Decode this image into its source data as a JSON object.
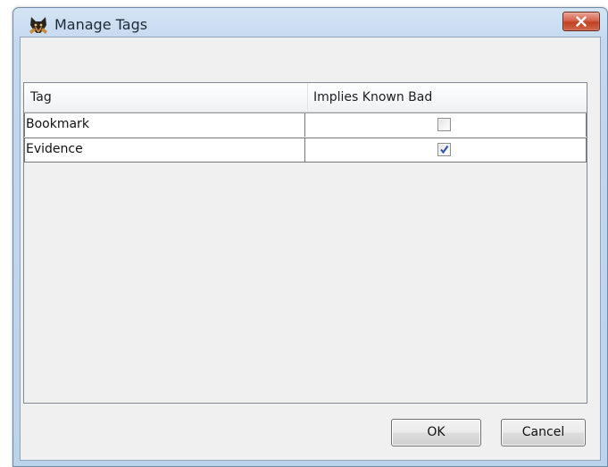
{
  "window": {
    "title": "Manage Tags",
    "app_icon": "dog-head-icon",
    "close_icon": "close-x-icon"
  },
  "table": {
    "columns": [
      "Tag",
      "Implies Known Bad"
    ],
    "rows": [
      {
        "tag": "Bookmark",
        "implies_known_bad": false
      },
      {
        "tag": "Evidence",
        "implies_known_bad": true
      }
    ]
  },
  "buttons": {
    "ok_label": "OK",
    "cancel_label": "Cancel"
  },
  "colors": {
    "title_bar": "#c4d8ee",
    "close_button": "#c1401f",
    "checkmark": "#2b4fa8"
  }
}
